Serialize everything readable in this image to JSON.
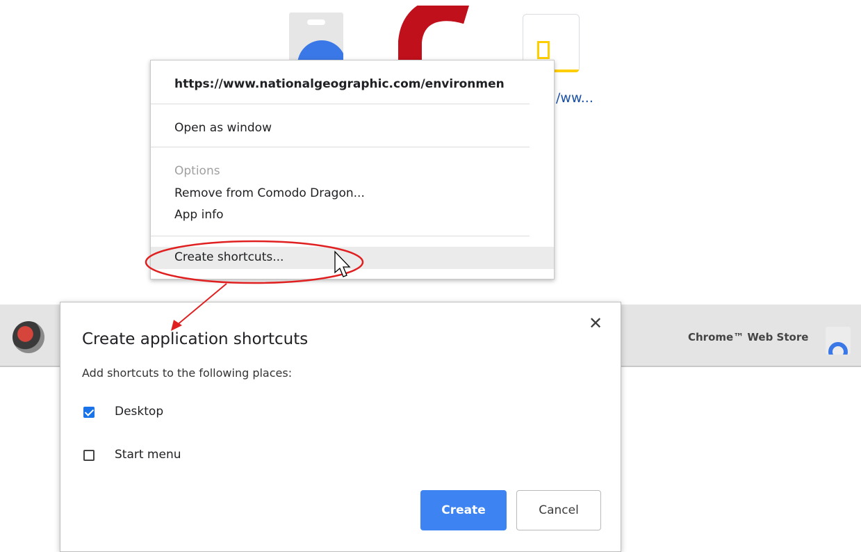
{
  "background": {
    "tile_label": "/ww...",
    "toolbar": {
      "webstore_label": "Chrome™ Web Store"
    }
  },
  "context_menu": {
    "url": "https://www.nationalgeographic.com/environmen",
    "items": {
      "open_as_window": "Open as window",
      "options": "Options",
      "remove": "Remove from Comodo Dragon...",
      "app_info": "App info",
      "create_shortcuts": "Create shortcuts..."
    }
  },
  "dialog": {
    "title": "Create application shortcuts",
    "close_glyph": "✕",
    "subtitle": "Add shortcuts to the following places:",
    "options": [
      {
        "label": "Desktop",
        "checked": true
      },
      {
        "label": "Start menu",
        "checked": false
      }
    ],
    "create_label": "Create",
    "cancel_label": "Cancel"
  },
  "colors": {
    "primary_button": "#3d83f1",
    "checkbox": "#1a73e8",
    "annotation": "#e02020"
  }
}
